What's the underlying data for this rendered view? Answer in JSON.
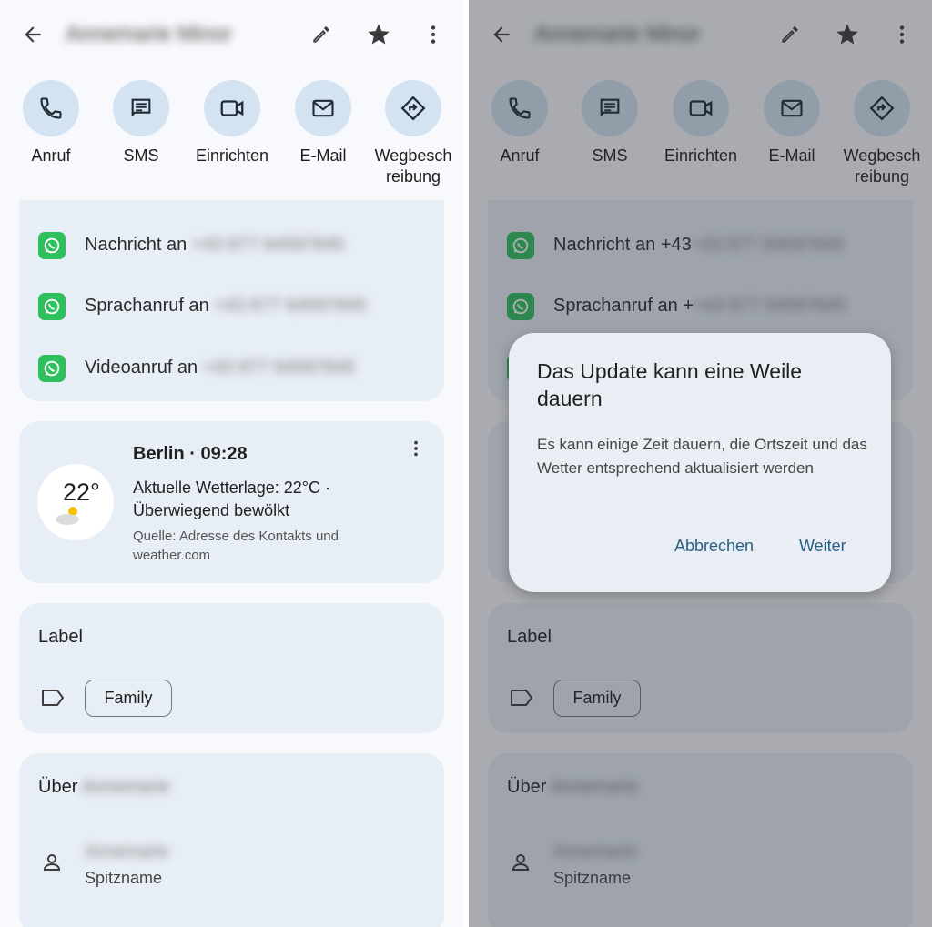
{
  "contact": {
    "name": "Annemarie Minor",
    "nickname": "Annemarie"
  },
  "topbar": {
    "back_icon": "arrow-back-icon",
    "edit_icon": "pencil-icon",
    "star_icon": "star-icon",
    "more_icon": "more-vert-icon"
  },
  "actions": [
    {
      "label": "Anruf",
      "icon": "phone-icon"
    },
    {
      "label": "SMS",
      "icon": "message-icon"
    },
    {
      "label": "Einrichten",
      "icon": "video-icon"
    },
    {
      "label": "E-Mail",
      "icon": "mail-icon"
    },
    {
      "label": "Wegbesch reibung",
      "icon": "directions-icon"
    }
  ],
  "whatsapp": {
    "rows": [
      {
        "prefix": "Nachricht an ",
        "number": "+43 677 64597845"
      },
      {
        "prefix": "Sprachanruf an ",
        "number": "+43 677 64597845"
      },
      {
        "prefix": "Videoanruf an ",
        "number": "+43 677 64597845"
      }
    ],
    "right_prefixes": [
      "Nachricht an +43",
      "Sprachanruf an +"
    ]
  },
  "weather": {
    "temp": "22°",
    "title": "Berlin · 09:28",
    "description": "Aktuelle Wetterlage: 22°C · Überwiegend bewölkt",
    "source": "Quelle: Adresse des Kontakts und weather.com"
  },
  "labels": {
    "title": "Label",
    "chip": "Family"
  },
  "about": {
    "title_prefix": "Über ",
    "nickname_label": "Spitzname"
  },
  "dialog": {
    "title": "Das Update kann eine Weile dauern",
    "body": "Es kann einige Zeit dauern, die Ortszeit und das Wetter entsprechend aktualisiert werden",
    "cancel": "Abbrechen",
    "confirm": "Weiter"
  },
  "colors": {
    "accent": "#2a5f86",
    "chip_bg": "#d3e3f2",
    "card_bg": "#e8eef5",
    "whatsapp": "#2fc05e"
  }
}
